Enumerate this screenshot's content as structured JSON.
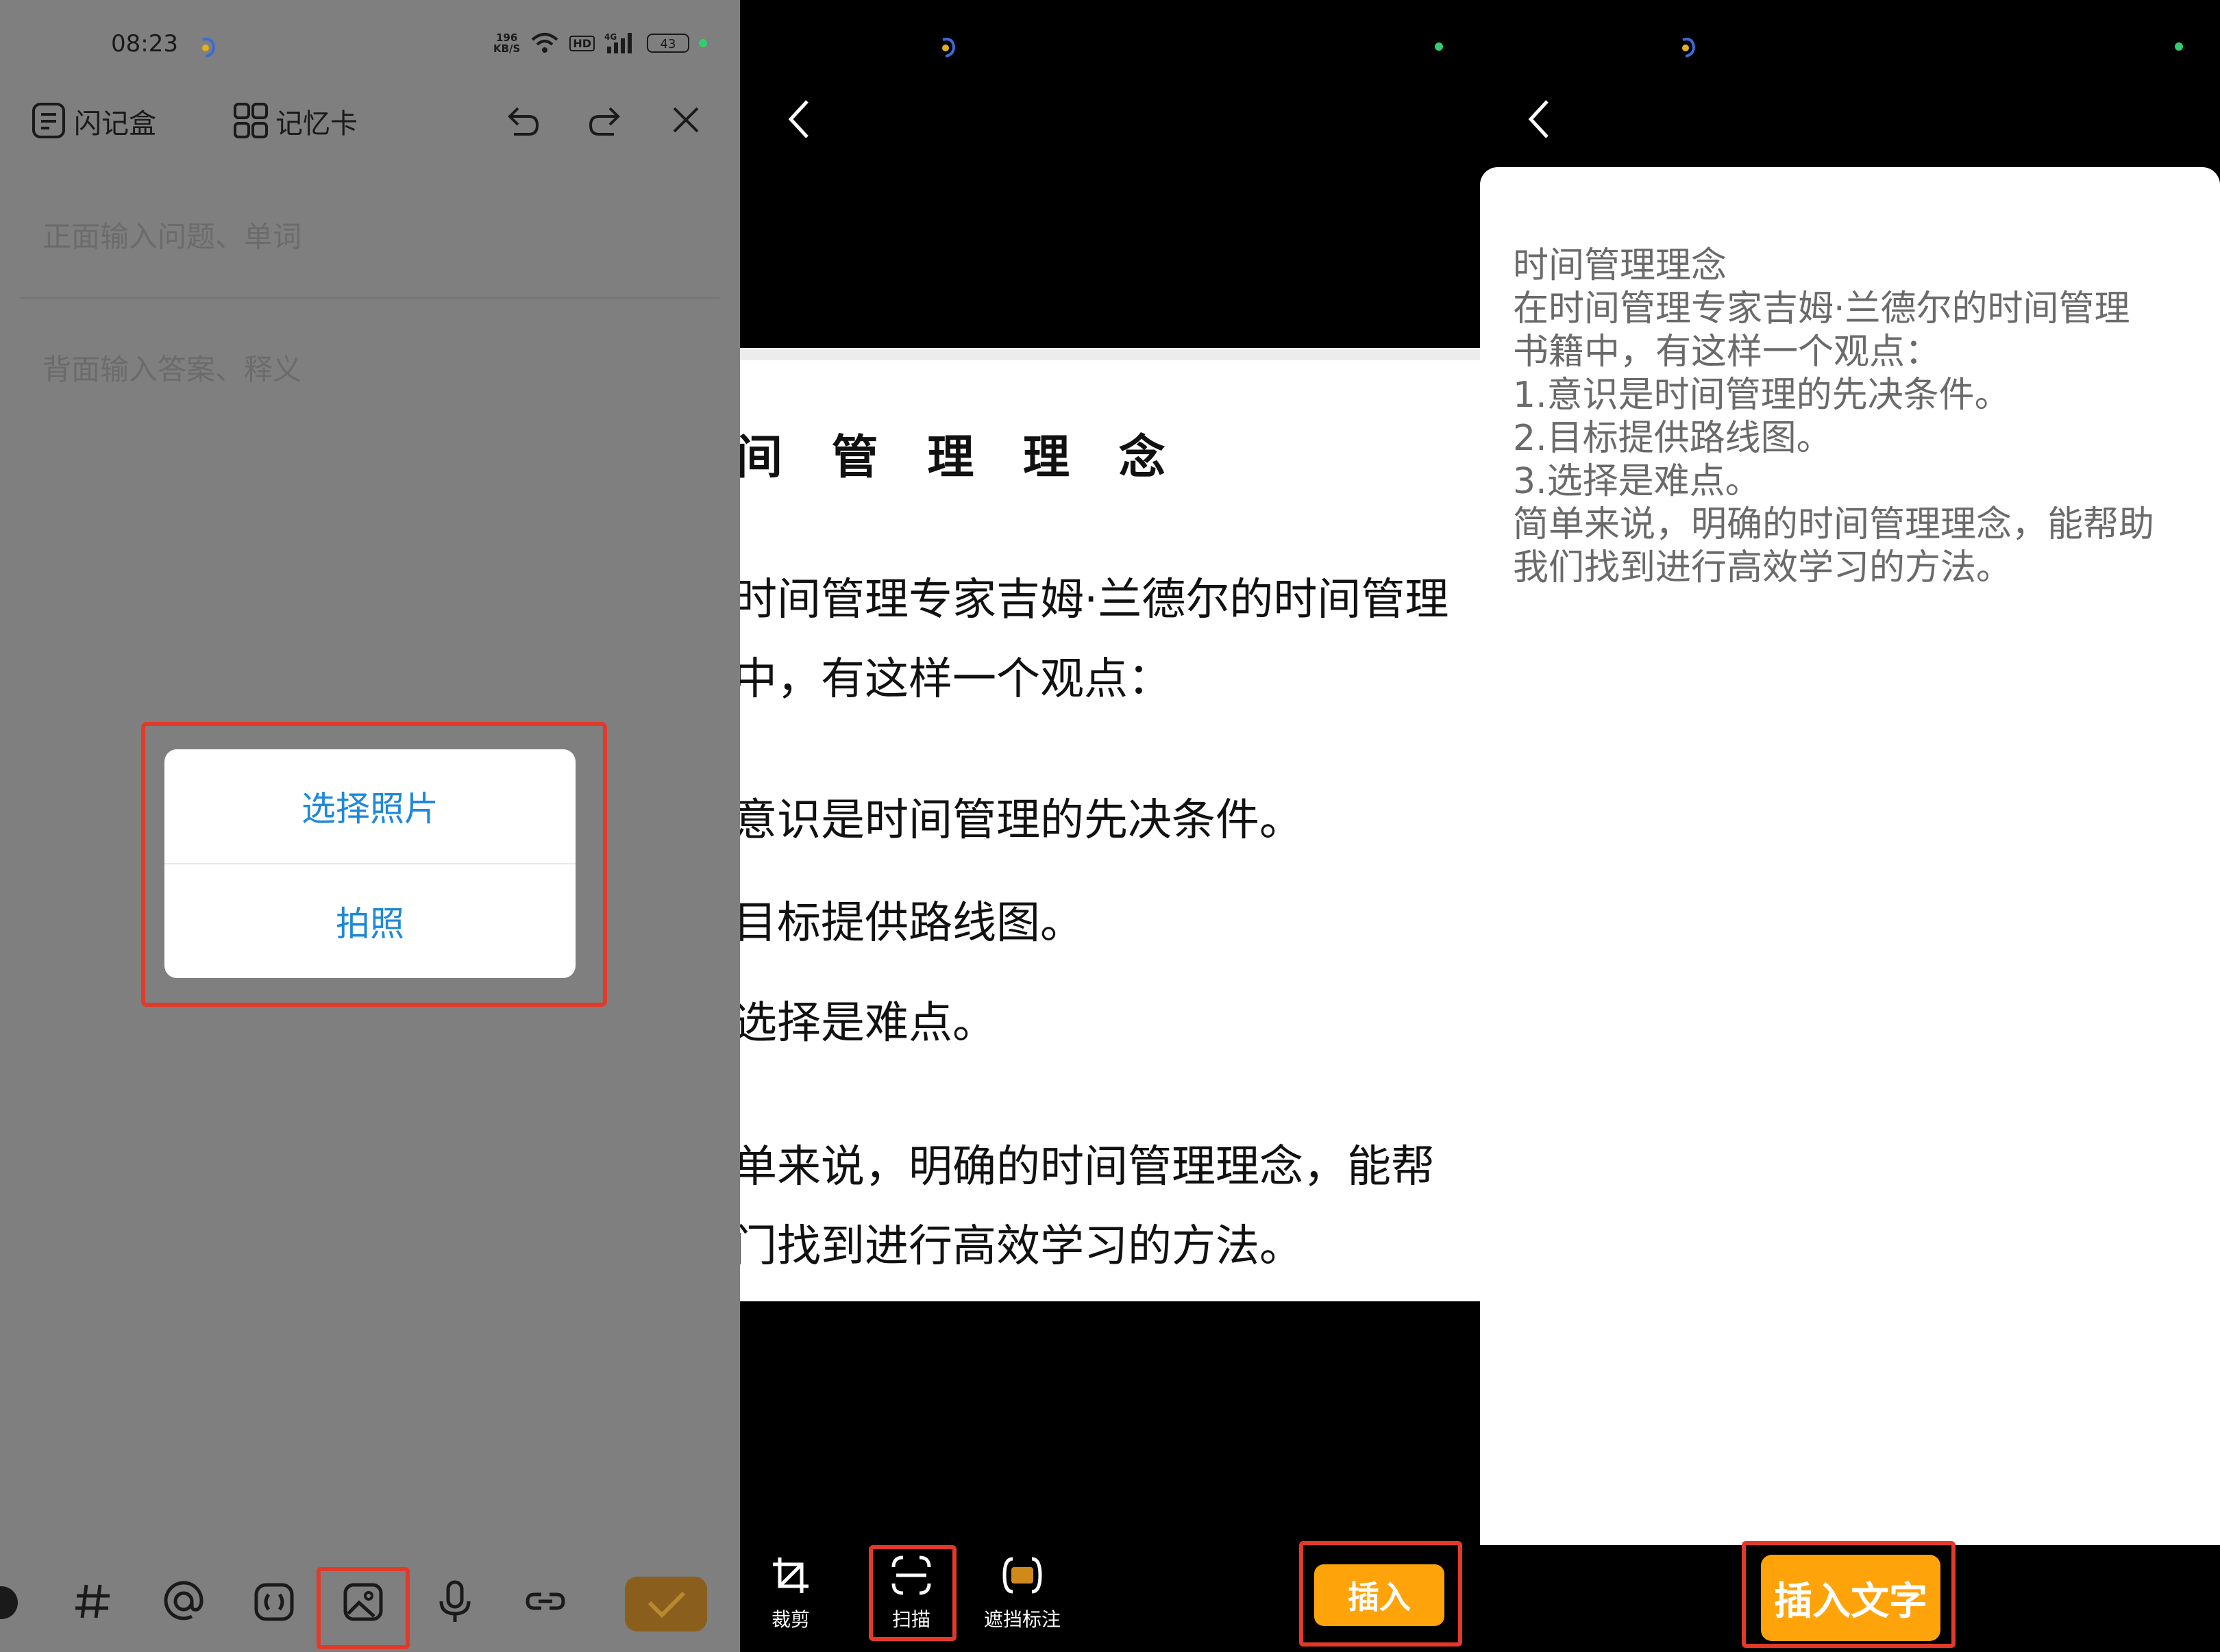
{
  "panel1": {
    "status": {
      "time": "08:23",
      "speed_top": "196",
      "speed_bottom": "KB/S",
      "hd": "HD",
      "net": "4G",
      "battery": "43"
    },
    "topbar": {
      "notes_label": "闪记盒",
      "cards_label": "记忆卡"
    },
    "front_placeholder": "正面输入问题、单词",
    "back_placeholder": "背面输入答案、释义",
    "popup": {
      "option_choose": "选择照片",
      "option_camera": "拍照"
    },
    "colors": {
      "accent_blue": "#1e88d8",
      "highlight_red": "#e23a2a",
      "overlay_gray": "#7f7f7f"
    }
  },
  "panel2": {
    "doc_title": "间 管 理 理 念",
    "doc_lines": [
      "时间管理专家吉姆·兰德尔的时间管理",
      "中，有这样一个观点：",
      "意识是时间管理的先决条件。",
      "目标提供路线图。",
      "选择是难点。",
      "单来说，明确的时间管理理念，能帮",
      "门找到进行高效学习的方法。"
    ],
    "tools": {
      "crop": "裁剪",
      "scan": "扫描",
      "mask": "遮挡标注"
    },
    "insert_label": "插入",
    "colors": {
      "orange": "#ffa30a"
    }
  },
  "panel3": {
    "ocr_lines": [
      "时间管理理念",
      "在时间管理专家吉姆·兰德尔的时间管理",
      "书籍中，有这样一个观点：",
      "1.意识是时间管理的先决条件。",
      "2.目标提供路线图。",
      "3.选择是难点。",
      "简单来说，明确的时间管理理念，能帮助",
      "我们找到进行高效学习的方法。"
    ],
    "insert_text_label": "插入文字"
  }
}
